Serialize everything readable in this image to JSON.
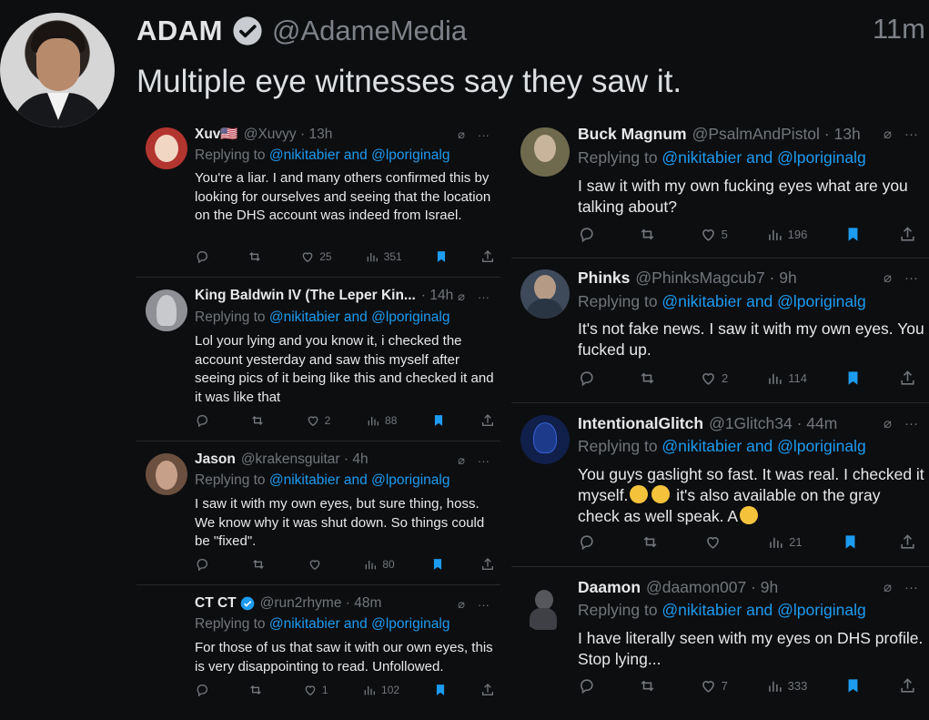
{
  "tweet": {
    "author_name": "ADAM",
    "author_handle": "@AdameMedia",
    "time_ago": "11m",
    "text": "Multiple eye witnesses say they saw it."
  },
  "replies_left": [
    {
      "name": "Xuv🇺🇸",
      "meta": "@Xuvyy · 13h",
      "replying_prefix": "Replying to ",
      "replying_mentions": "@nikitabier and @lporiginalg",
      "text": "You're a liar. I and many others confirmed this by looking for ourselves and seeing that the location on the DHS account was indeed from Israel.",
      "replies": "",
      "retweets": "",
      "likes": "25",
      "views": "351",
      "avatar_color": "#b3352f"
    },
    {
      "name": "King Baldwin IV (The Leper Kin...",
      "meta": "· 14h",
      "replying_prefix": "Replying to ",
      "replying_mentions": "@nikitabier and @lporiginalg",
      "text": "Lol your lying and you know it, i checked the account yesterday and saw this myself after seeing pics of it being like this and checked it and it was like that",
      "replies": "",
      "retweets": "",
      "likes": "2",
      "views": "88",
      "avatar_color": "#8f9096"
    },
    {
      "name": "Jason",
      "meta": "@krakensguitar · 4h",
      "replying_prefix": "Replying to ",
      "replying_mentions": "@nikitabier and @lporiginalg",
      "text": "I saw it with my own eyes, but sure thing, hoss. We know why it was shut down. So things could be \"fixed\".",
      "replies": "",
      "retweets": "",
      "likes": "",
      "views": "80",
      "avatar_color": "#6b5040"
    },
    {
      "name": "CT CT",
      "meta": "@run2rhyme · 48m",
      "replying_prefix": "Replying to ",
      "replying_mentions": "@nikitabier and @lporiginalg",
      "text": "For those of us that saw it with our own eyes, this is very disappointing to read. Unfollowed.",
      "replies": "",
      "retweets": "",
      "likes": "1",
      "views": "102",
      "avatar_color": "#0d0e10"
    }
  ],
  "replies_right": [
    {
      "name": "Buck Magnum",
      "meta": "@PsalmAndPistol · 13h",
      "replying_prefix": "Replying to ",
      "replying_mentions": "@nikitabier and @lporiginalg",
      "text": "I saw it with my own fucking eyes what are you talking about?",
      "replies": "",
      "retweets": "",
      "likes": "5",
      "views": "196",
      "avatar_color": "#6f6a4e"
    },
    {
      "name": "Phinks",
      "meta": "@PhinksMagcub7 · 9h",
      "replying_prefix": "Replying to ",
      "replying_mentions": "@nikitabier and @lporiginalg",
      "text": "It's not fake news. I saw it with my own eyes. You fucked up.",
      "replies": "",
      "retweets": "",
      "likes": "2",
      "views": "114",
      "avatar_color": "#3e4a5a"
    },
    {
      "name": "IntentionalGlitch",
      "meta": "@1Glitch34 · 44m",
      "replying_prefix": "Replying to ",
      "replying_mentions": "@nikitabier and @lporiginalg",
      "text_a": "You guys gaslight so fast. It was real. I checked it myself.",
      "text_b": " it's also available on the gray check as well speak. A",
      "replies": "",
      "retweets": "",
      "likes": "",
      "views": "21",
      "avatar_color": "#1d3a8a"
    },
    {
      "name": "Daamon",
      "meta": "@daamon007 · 9h",
      "replying_prefix": "Replying to ",
      "replying_mentions": "@nikitabier and @lporiginalg",
      "text": "I have literally seen with my eyes on  DHS profile. Stop lying...",
      "replies": "",
      "retweets": "",
      "likes": "7",
      "views": "333",
      "avatar_color": "#55575c"
    }
  ],
  "tools": {
    "grok": "⌀",
    "more": "···"
  }
}
